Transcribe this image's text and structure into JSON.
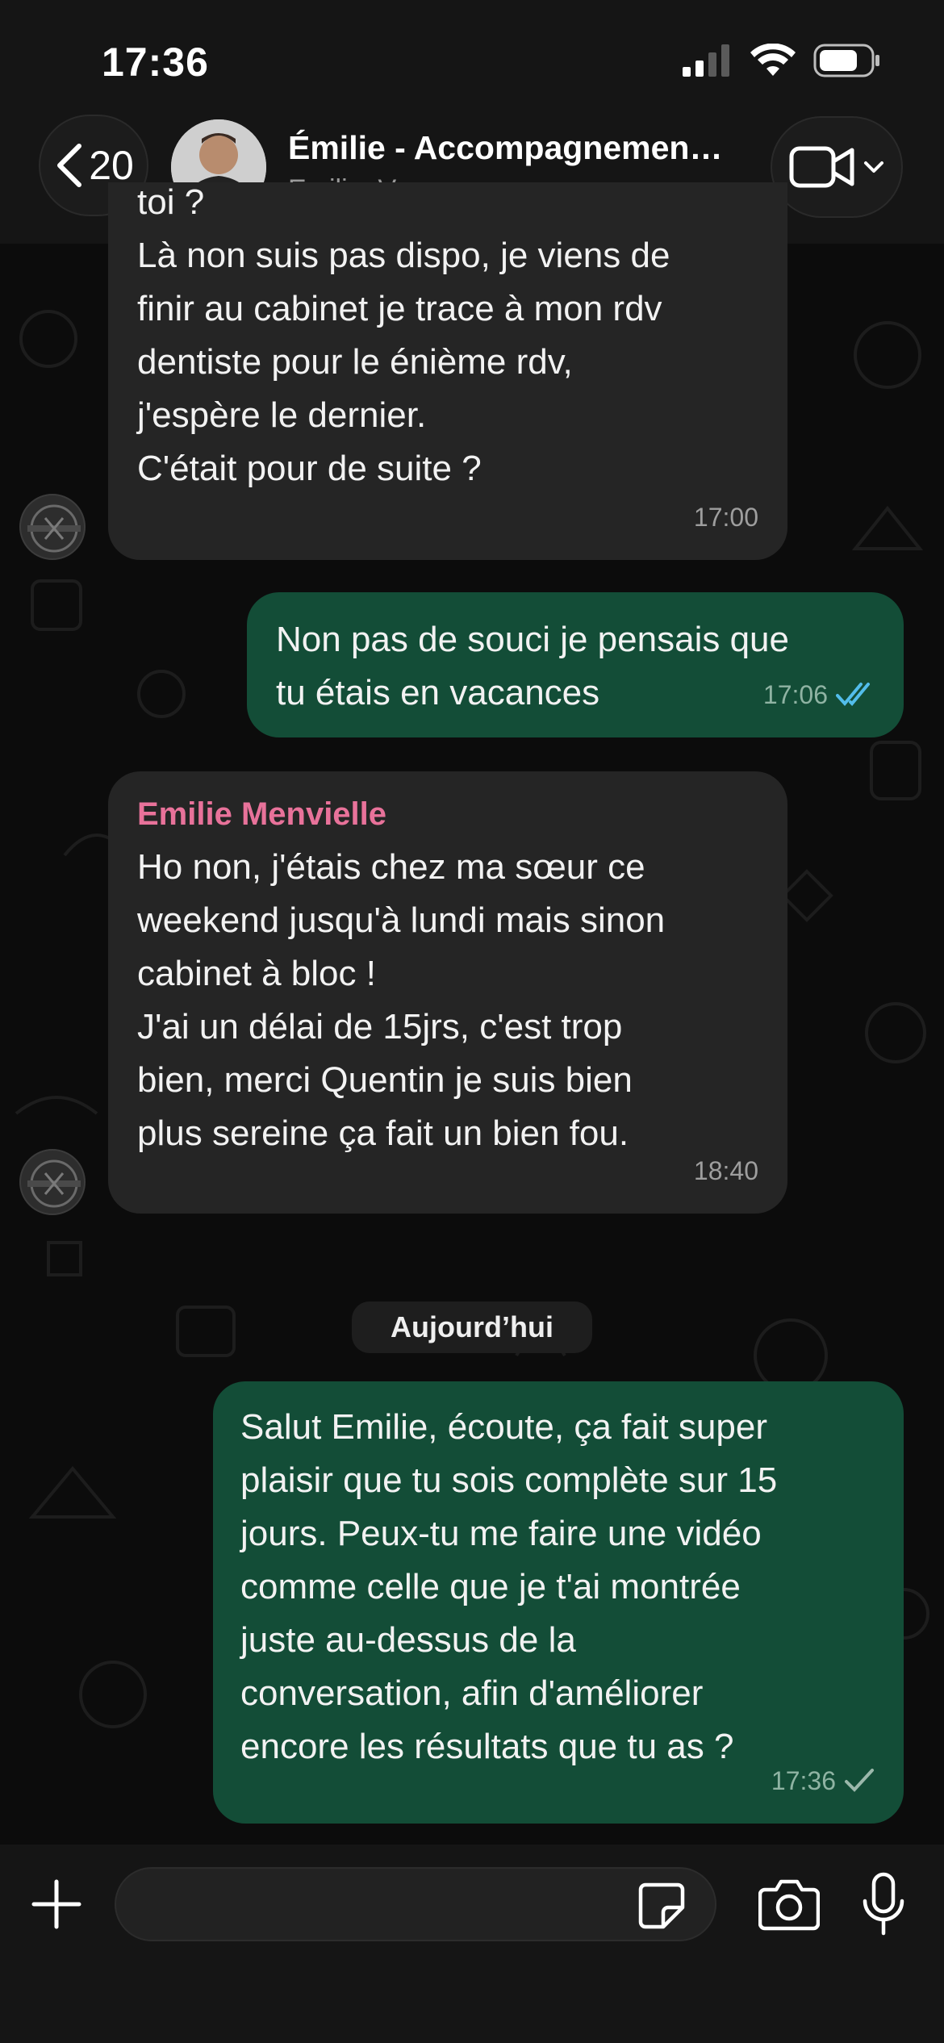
{
  "status_bar": {
    "time": "17:36"
  },
  "header": {
    "back_count": "20",
    "title": "Émilie - Accompagnemen…",
    "subtitle": "Emilie, Vous"
  },
  "messages": [
    {
      "direction": "incoming",
      "text": "toi ?\nLà non suis pas dispo, je viens de\nfinir au cabinet je trace à mon rdv\ndentiste pour le énième rdv,\nj'espère le dernier.\nC'était pour de suite ?",
      "time": "17:00"
    },
    {
      "direction": "outgoing",
      "text": "Non pas de souci je pensais que\ntu étais en vacances",
      "time": "17:06",
      "status": "read"
    },
    {
      "direction": "incoming",
      "sender": "Emilie Menvielle",
      "text": "Ho non, j'étais chez ma sœur ce\nweekend jusqu'à lundi mais sinon\ncabinet à bloc !\nJ'ai un délai de 15jrs, c'est trop\nbien, merci Quentin je suis bien\nplus sereine ça fait un bien fou.",
      "time": "18:40"
    },
    {
      "direction": "outgoing",
      "text": "Salut Emilie, écoute, ça fait super\nplaisir que tu sois complète sur 15\njours. Peux-tu me faire une vidéo\ncomme celle que je t'ai montrée\njuste au-dessus de la\nconversation, afin d'améliorer\nencore les résultats que tu as ?",
      "time": "17:36",
      "status": "sent"
    }
  ],
  "day_separator": "Aujourd’hui",
  "composer": {
    "placeholder": ""
  },
  "colors": {
    "outgoing_bubble": "#134d37",
    "incoming_bubble": "#252525",
    "sender_name": "#e8729a",
    "read_ticks": "#53bdeb"
  }
}
